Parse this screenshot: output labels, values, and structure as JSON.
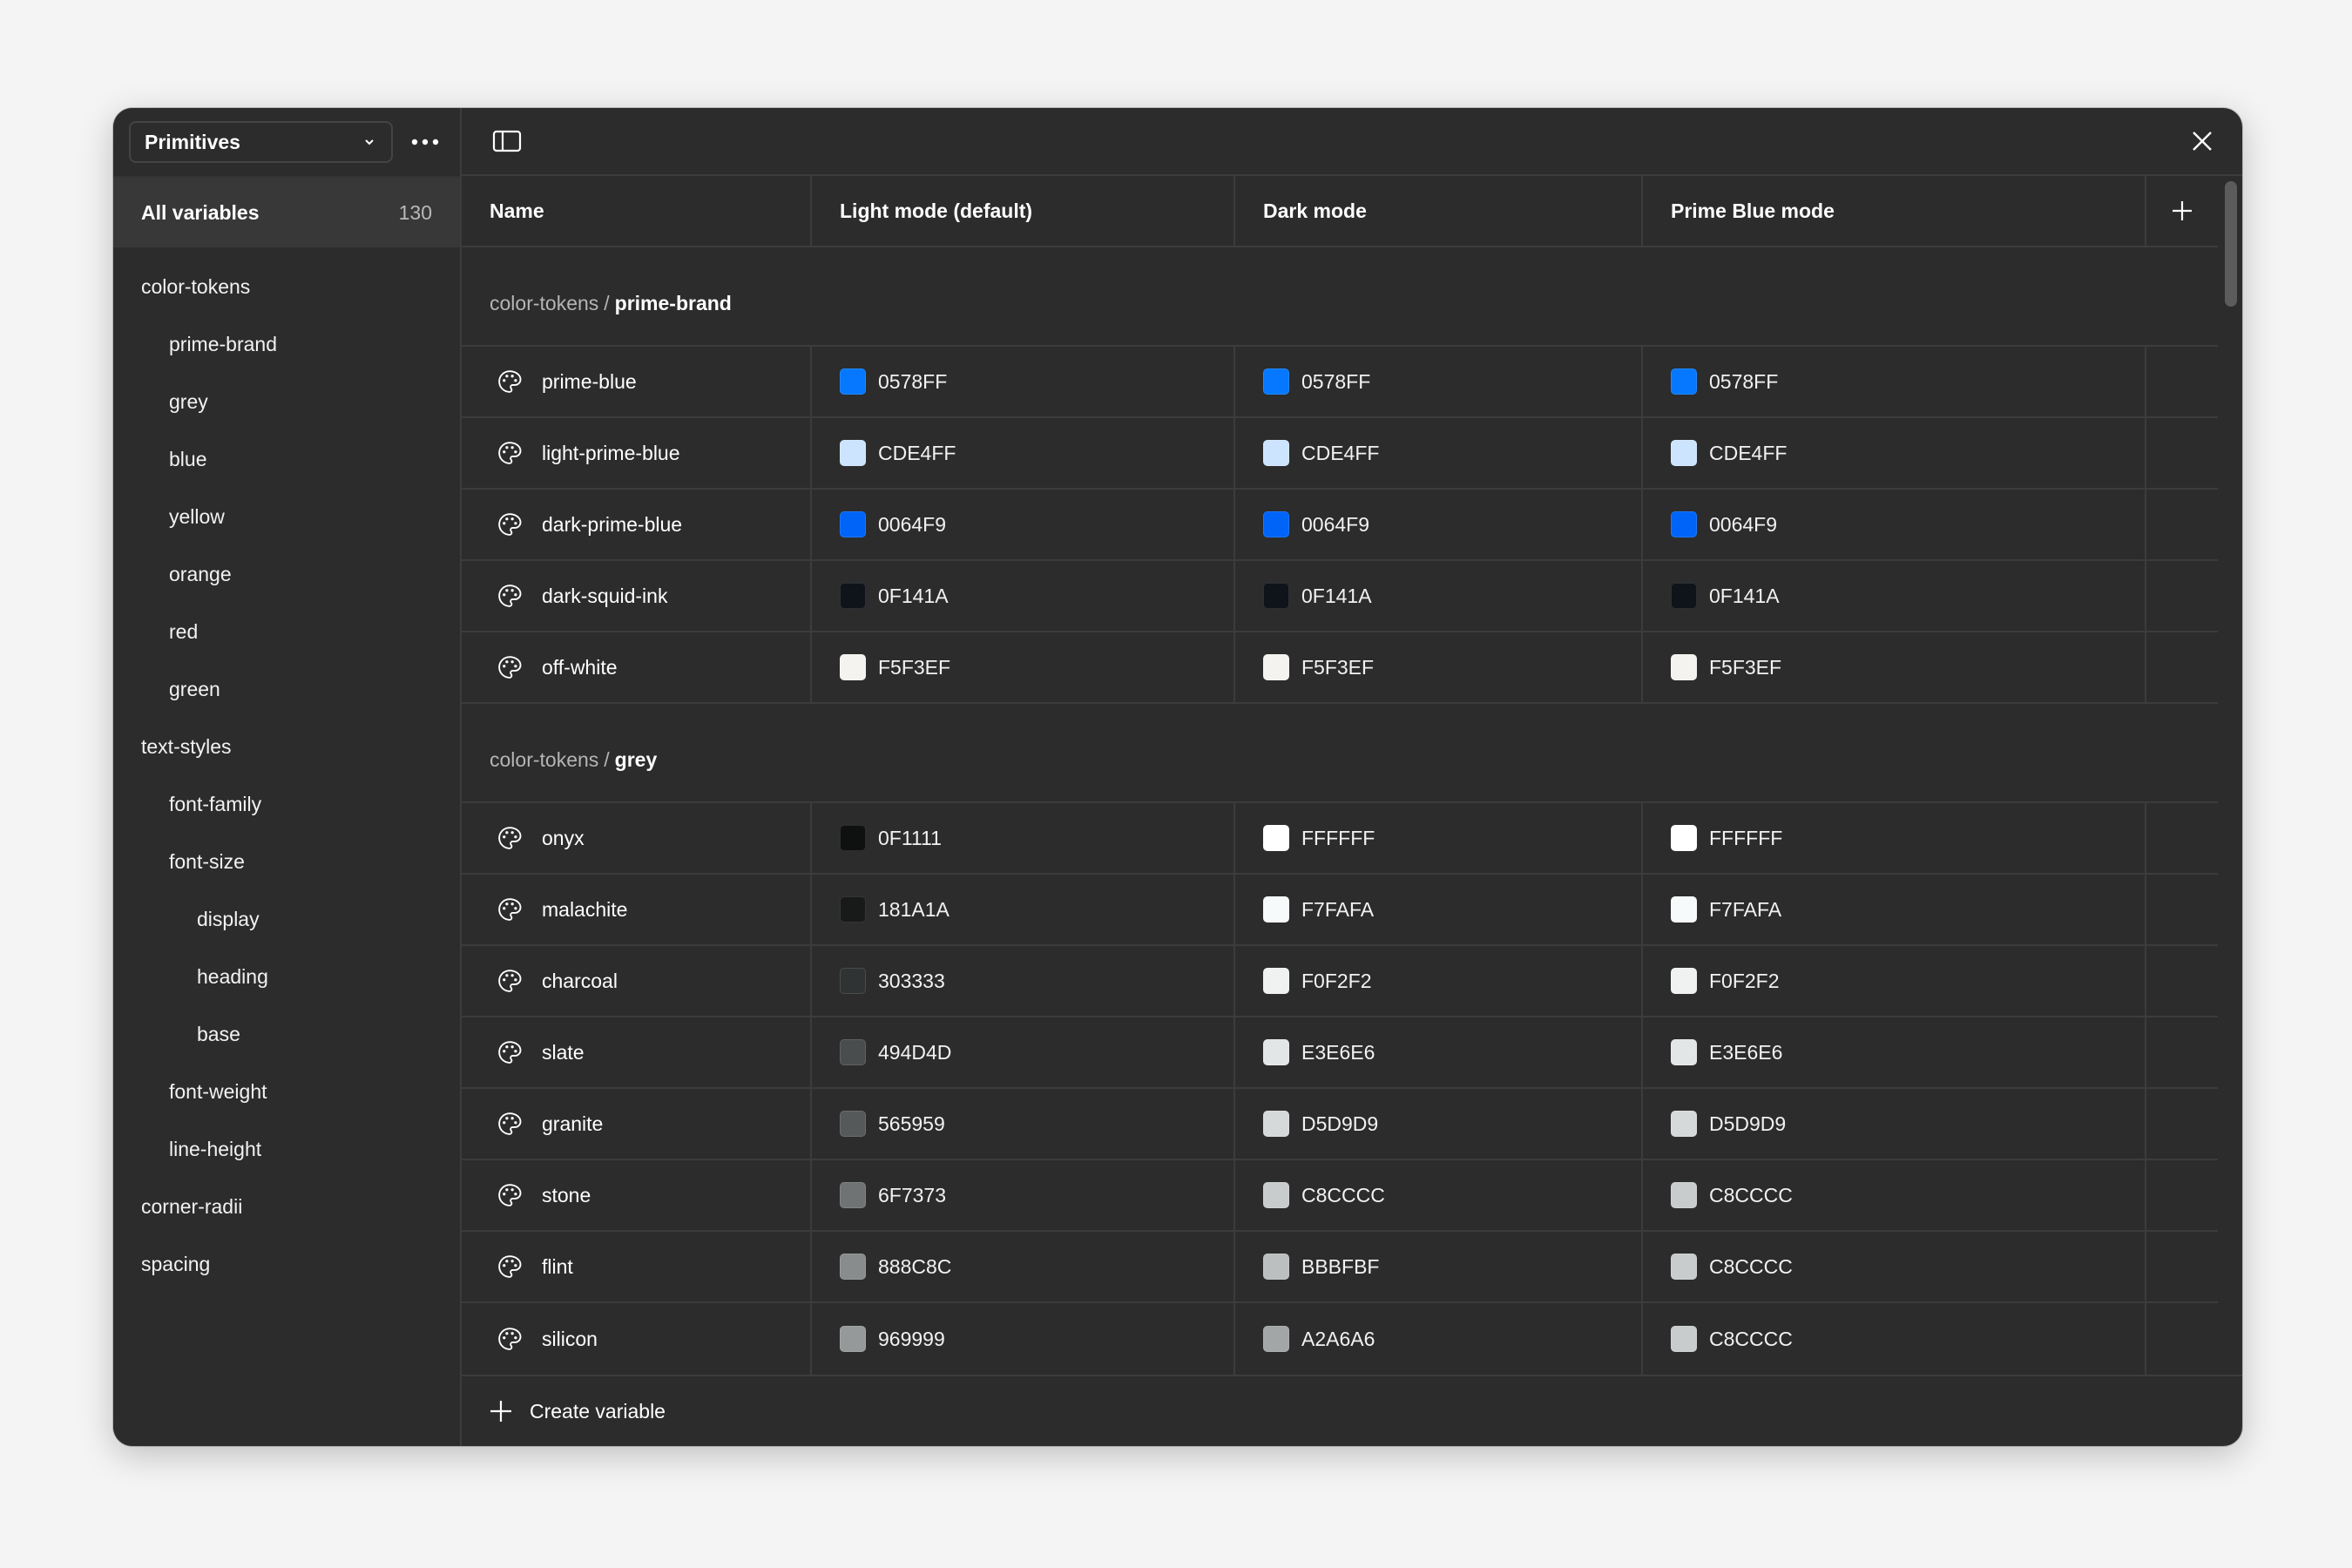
{
  "sidebar": {
    "collection": "Primitives",
    "all_variables_label": "All variables",
    "all_variables_count": "130",
    "groups": [
      {
        "label": "color-tokens",
        "level": 0
      },
      {
        "label": "prime-brand",
        "level": 1
      },
      {
        "label": "grey",
        "level": 1
      },
      {
        "label": "blue",
        "level": 1
      },
      {
        "label": "yellow",
        "level": 1
      },
      {
        "label": "orange",
        "level": 1
      },
      {
        "label": "red",
        "level": 1
      },
      {
        "label": "green",
        "level": 1
      },
      {
        "label": "text-styles",
        "level": 0
      },
      {
        "label": "font-family",
        "level": 1
      },
      {
        "label": "font-size",
        "level": 1
      },
      {
        "label": "display",
        "level": 2
      },
      {
        "label": "heading",
        "level": 2
      },
      {
        "label": "base",
        "level": 2
      },
      {
        "label": "font-weight",
        "level": 1
      },
      {
        "label": "line-height",
        "level": 1
      },
      {
        "label": "corner-radii",
        "level": 0
      },
      {
        "label": "spacing",
        "level": 0
      }
    ]
  },
  "table": {
    "columns": [
      "Name",
      "Light mode (default)",
      "Dark mode",
      "Prime Blue mode"
    ]
  },
  "sections": [
    {
      "prefix": "color-tokens",
      "separator": "/",
      "name": "prime-brand",
      "rows": [
        {
          "name": "prime-blue",
          "values": [
            "0578FF",
            "0578FF",
            "0578FF"
          ]
        },
        {
          "name": "light-prime-blue",
          "values": [
            "CDE4FF",
            "CDE4FF",
            "CDE4FF"
          ]
        },
        {
          "name": "dark-prime-blue",
          "values": [
            "0064F9",
            "0064F9",
            "0064F9"
          ]
        },
        {
          "name": "dark-squid-ink",
          "values": [
            "0F141A",
            "0F141A",
            "0F141A"
          ]
        },
        {
          "name": "off-white",
          "values": [
            "F5F3EF",
            "F5F3EF",
            "F5F3EF"
          ]
        }
      ]
    },
    {
      "prefix": "color-tokens",
      "separator": "/",
      "name": "grey",
      "rows": [
        {
          "name": "onyx",
          "values": [
            "0F1111",
            "FFFFFF",
            "FFFFFF"
          ]
        },
        {
          "name": "malachite",
          "values": [
            "181A1A",
            "F7FAFA",
            "F7FAFA"
          ]
        },
        {
          "name": "charcoal",
          "values": [
            "303333",
            "F0F2F2",
            "F0F2F2"
          ]
        },
        {
          "name": "slate",
          "values": [
            "494D4D",
            "E3E6E6",
            "E3E6E6"
          ]
        },
        {
          "name": "granite",
          "values": [
            "565959",
            "D5D9D9",
            "D5D9D9"
          ]
        },
        {
          "name": "stone",
          "values": [
            "6F7373",
            "C8CCCC",
            "C8CCCC"
          ]
        },
        {
          "name": "flint",
          "values": [
            "888C8C",
            "BBBFBF",
            "C8CCCC"
          ]
        },
        {
          "name": "silicon",
          "values": [
            "969999",
            "A2A6A6",
            "C8CCCC"
          ]
        }
      ]
    }
  ],
  "footer": {
    "create_label": "Create variable"
  },
  "icons": {
    "row_icon": "palette-icon",
    "chevron": "chevron-down-icon",
    "more": "more-horizontal-icon",
    "sidebar_toggle": "sidebar-toggle-icon",
    "close": "close-icon",
    "add": "plus-icon"
  }
}
